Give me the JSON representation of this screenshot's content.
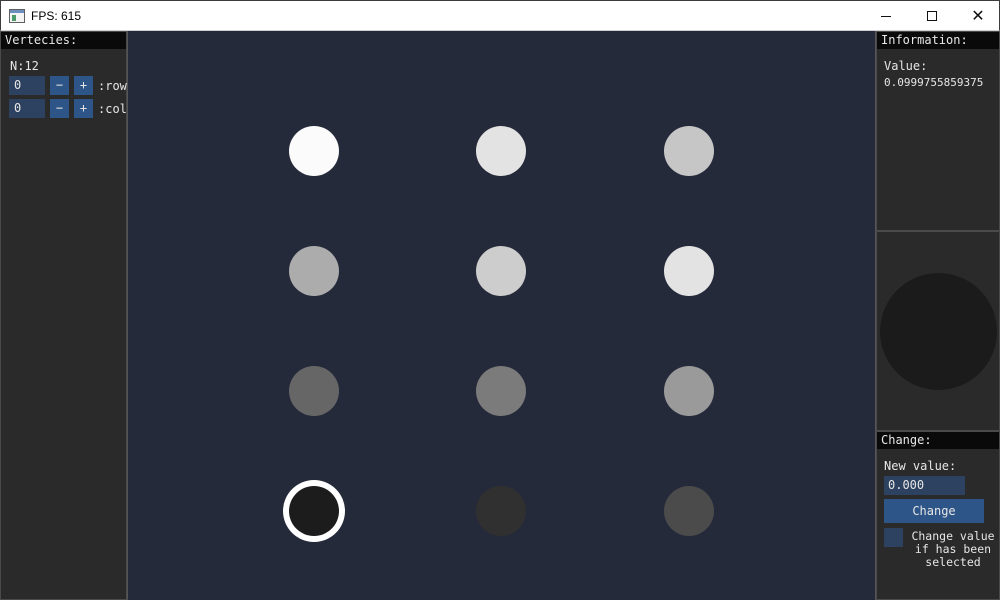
{
  "window": {
    "title": "FPS: 615"
  },
  "vertices_panel": {
    "header": "Vertecies:",
    "count_label": "N:12",
    "row": {
      "value": "0",
      "minus": "−",
      "plus": "+",
      "label": ":row"
    },
    "col": {
      "value": "0",
      "minus": "−",
      "plus": "+",
      "label": ":col"
    }
  },
  "grid": {
    "rows": 4,
    "cols": 3,
    "vertices": [
      {
        "color": "#fbfbfb",
        "selected": false
      },
      {
        "color": "#e3e3e3",
        "selected": false
      },
      {
        "color": "#c6c6c6",
        "selected": false
      },
      {
        "color": "#acacac",
        "selected": false
      },
      {
        "color": "#cdcdcd",
        "selected": false
      },
      {
        "color": "#e3e3e3",
        "selected": false
      },
      {
        "color": "#666666",
        "selected": false
      },
      {
        "color": "#7b7b7b",
        "selected": false
      },
      {
        "color": "#9a9a9a",
        "selected": false
      },
      {
        "color": "#1c1c1c",
        "selected": true
      },
      {
        "color": "#303030",
        "selected": false
      },
      {
        "color": "#4b4b4b",
        "selected": false
      }
    ]
  },
  "info_panel": {
    "header": "Information:",
    "value_label": "Value:",
    "value": "0.0999755859375"
  },
  "preview": {
    "color": "#1b1b1b"
  },
  "change_panel": {
    "header": "Change:",
    "new_value_label": "New value:",
    "new_value": "0.000",
    "button_label": "Change",
    "checkbox_label": "Change value\nif has been\nselected"
  }
}
